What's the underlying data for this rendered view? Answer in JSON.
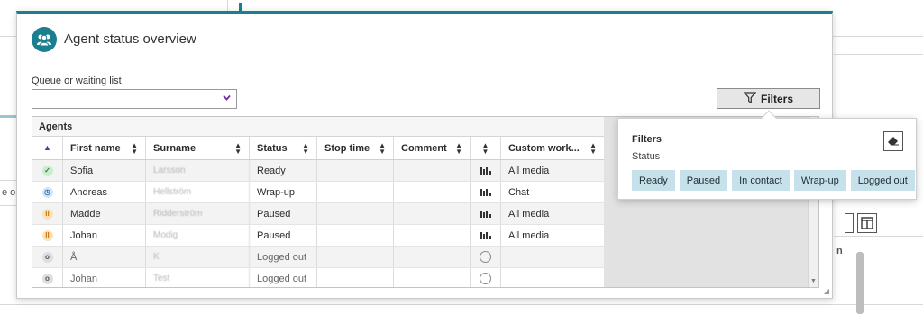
{
  "dialog": {
    "title": "Agent status overview",
    "queue_label": "Queue or waiting list",
    "queue_value": "",
    "filters_button": "Filters"
  },
  "grid": {
    "title": "Agents",
    "columns": [
      "",
      "First name",
      "Surname",
      "Status",
      "Stop time",
      "Comment",
      "",
      "Custom work..."
    ],
    "rows": [
      {
        "status_icon": "ready",
        "first": "Sofia",
        "surname": "Larsson",
        "status": "Ready",
        "stop": "",
        "comment": "",
        "media_icon": "bars",
        "custom": "All media"
      },
      {
        "status_icon": "wrap",
        "first": "Andreas",
        "surname": "Hellström",
        "status": "Wrap-up",
        "stop": "",
        "comment": "",
        "media_icon": "bars",
        "custom": "Chat"
      },
      {
        "status_icon": "paused",
        "first": "Madde",
        "surname": "Ridderström",
        "status": "Paused",
        "stop": "",
        "comment": "",
        "media_icon": "bars",
        "custom": "All media"
      },
      {
        "status_icon": "paused",
        "first": "Johan",
        "surname": "Modig",
        "status": "Paused",
        "stop": "",
        "comment": "",
        "media_icon": "bars",
        "custom": "All media"
      },
      {
        "status_icon": "out",
        "first": "Å",
        "surname": "K",
        "status": "Logged out",
        "stop": "",
        "comment": "",
        "media_icon": "ring",
        "custom": ""
      },
      {
        "status_icon": "out",
        "first": "Johan",
        "surname": "Test",
        "status": "Logged out",
        "stop": "",
        "comment": "",
        "media_icon": "ring",
        "custom": ""
      }
    ]
  },
  "filters_popover": {
    "title": "Filters",
    "subtitle": "Status",
    "chips": [
      "Ready",
      "Paused",
      "In contact",
      "Wrap-up",
      "Logged out"
    ]
  },
  "background": {
    "left_text": "e or",
    "column_fragment": "n"
  },
  "colors": {
    "accent": "#1b7f8f",
    "chip": "#c7e1ea",
    "ready": "#1f8a3a",
    "wrap": "#2c6bb4",
    "paused": "#c97a12"
  }
}
